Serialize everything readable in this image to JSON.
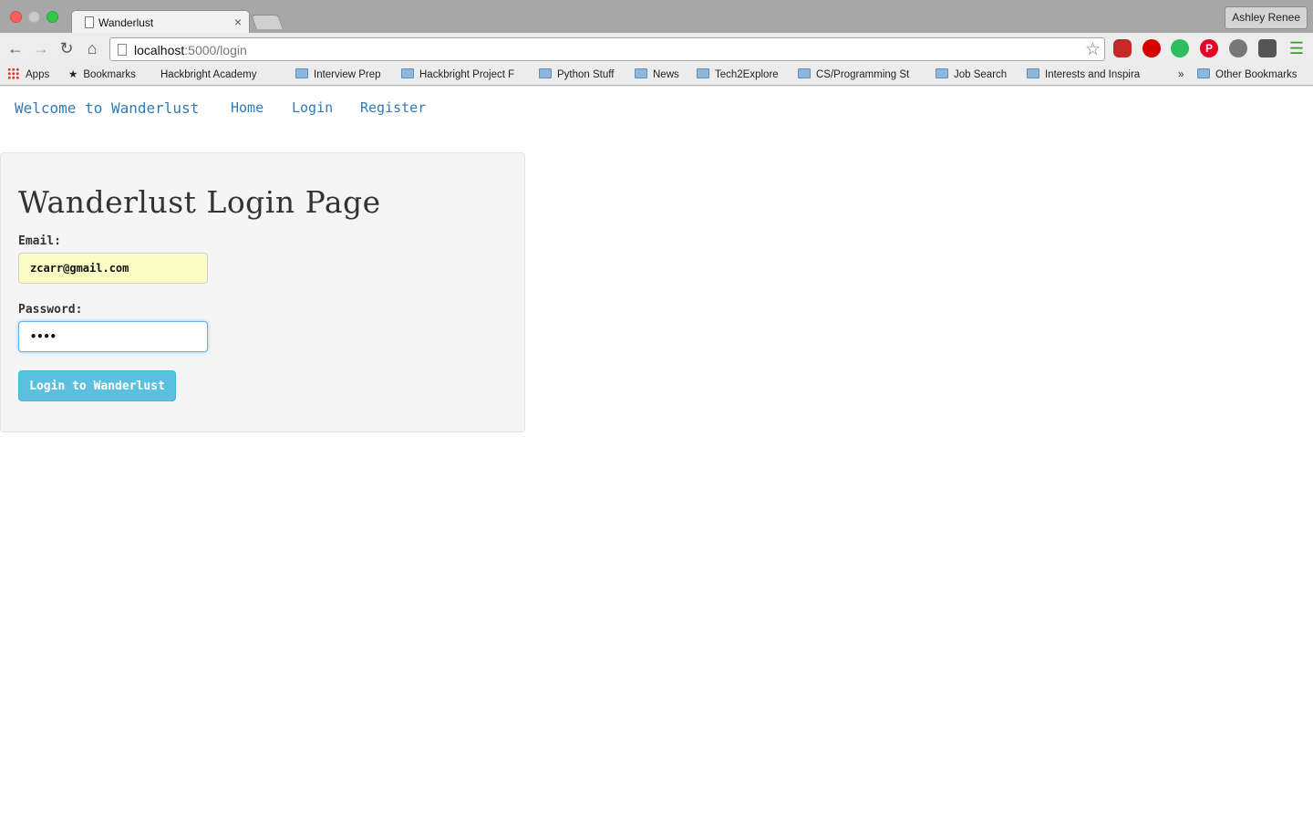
{
  "browser": {
    "tab_title": "Wanderlust",
    "tab_close": "×",
    "profile_name": "Ashley Renee",
    "url_host": "localhost",
    "url_path": ":5000/login",
    "bookmarks": [
      {
        "label": "Apps",
        "type": "apps"
      },
      {
        "label": "Bookmarks",
        "type": "star"
      },
      {
        "label": "Hackbright Academy",
        "type": "page"
      },
      {
        "label": "Interview Prep",
        "type": "folder"
      },
      {
        "label": "Hackbright Project F",
        "type": "folder"
      },
      {
        "label": "Python Stuff",
        "type": "folder"
      },
      {
        "label": "News",
        "type": "folder"
      },
      {
        "label": "Tech2Explore",
        "type": "folder"
      },
      {
        "label": "CS/Programming St",
        "type": "folder"
      },
      {
        "label": "Job Search",
        "type": "folder"
      },
      {
        "label": "Interests and Inspira",
        "type": "folder"
      },
      {
        "label": "»",
        "type": "overflow"
      },
      {
        "label": "Other Bookmarks",
        "type": "folder"
      }
    ]
  },
  "navbar": {
    "brand": "Welcome to Wanderlust",
    "home": "Home",
    "login": "Login",
    "register": "Register"
  },
  "login": {
    "title": "Wanderlust Login Page",
    "email_label": "Email:",
    "email_value": "zcarr@gmail.com",
    "password_label": "Password:",
    "password_value": "••••",
    "submit_label": "Login to Wanderlust"
  },
  "colors": {
    "link": "#337ab7",
    "button": "#5bc0de",
    "autofill": "#fbfdc5"
  }
}
